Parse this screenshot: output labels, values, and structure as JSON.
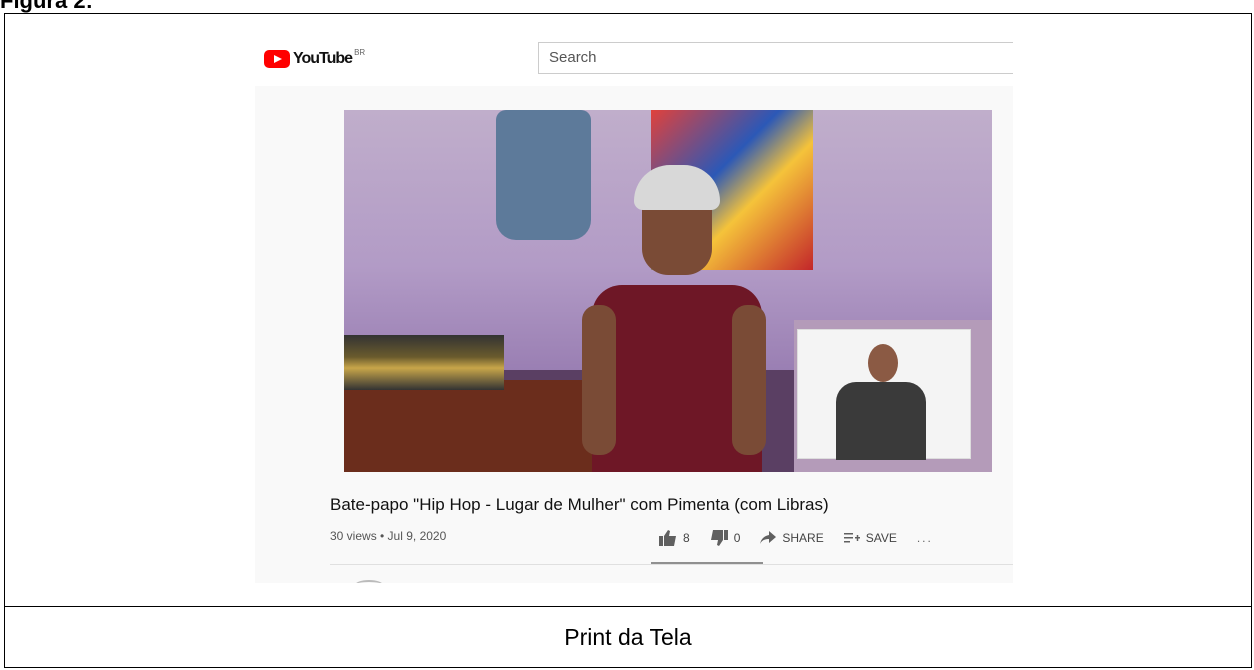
{
  "figure_label": "Figura 2:",
  "caption": "Print da Tela",
  "youtube": {
    "logo_text": "YouTube",
    "region": "BR",
    "search_placeholder": "Search"
  },
  "video": {
    "title": "Bate-papo \"Hip Hop - Lugar de Mulher\" com Pimenta (com Libras)",
    "meta": "30 views • Jul 9, 2020",
    "likes": "8",
    "dislikes": "0",
    "share_label": "SHARE",
    "save_label": "SAVE",
    "more_label": "..."
  },
  "colors": {
    "brand_red": "#ff0000"
  }
}
